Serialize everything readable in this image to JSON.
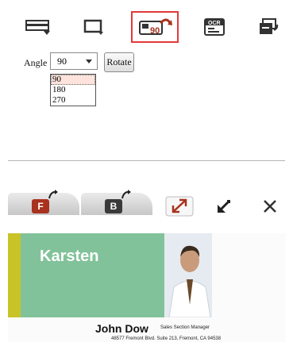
{
  "toolbar": {
    "buttons": [
      {
        "icon": "scan-card-icon",
        "active": false
      },
      {
        "icon": "window-icon",
        "active": false
      },
      {
        "icon": "rotate-90-icon",
        "label": "90",
        "active": true
      },
      {
        "icon": "ocr-icon",
        "label": "OCR",
        "active": false
      },
      {
        "icon": "export-card-icon",
        "active": false
      }
    ]
  },
  "rotate_panel": {
    "angle_label": "Angle",
    "angle_value": "90",
    "rotate_button": "Rotate",
    "options": [
      "90",
      "180",
      "270"
    ],
    "selected_option": "90"
  },
  "side_controls": {
    "front_label": "F",
    "back_label": "B",
    "front_color": "#a8321e",
    "back_color": "#3a3a3a"
  },
  "card_preview": {
    "display_name": "Karsten",
    "person_name": "John Dow",
    "person_title": "Sales Section Manager",
    "address_line": "48577 Fremont Blvd. Suite 213, Fremont, CA 94538"
  }
}
